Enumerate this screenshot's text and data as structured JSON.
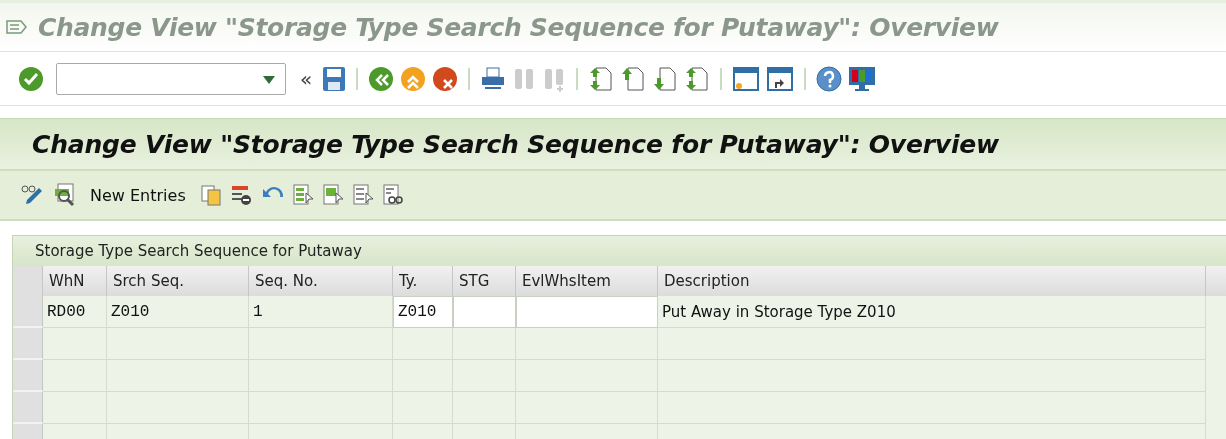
{
  "window": {
    "title": "Change View \"Storage Type Search Sequence for Putaway\": Overview"
  },
  "toolbar": {
    "collapse_glyph": "«"
  },
  "view": {
    "title": "Change View \"Storage Type Search Sequence for Putaway\": Overview"
  },
  "app_toolbar": {
    "new_entries": "New Entries"
  },
  "table": {
    "title": "Storage Type Search Sequence for Putaway",
    "columns": [
      "WhN",
      "Srch Seq.",
      "Seq. No.",
      "Ty.",
      "STG",
      "EvlWhsItem",
      "Description"
    ],
    "rows": [
      {
        "selected": false,
        "cells": [
          {
            "kind": "key",
            "text": "RD00"
          },
          {
            "kind": "key",
            "text": "Z010"
          },
          {
            "kind": "key",
            "text": "1"
          },
          {
            "kind": "input",
            "text": "Z010"
          },
          {
            "kind": "input"
          },
          {
            "kind": "input"
          },
          {
            "kind": "text",
            "text": "Put Away in Storage Type Z010"
          }
        ]
      }
    ]
  }
}
